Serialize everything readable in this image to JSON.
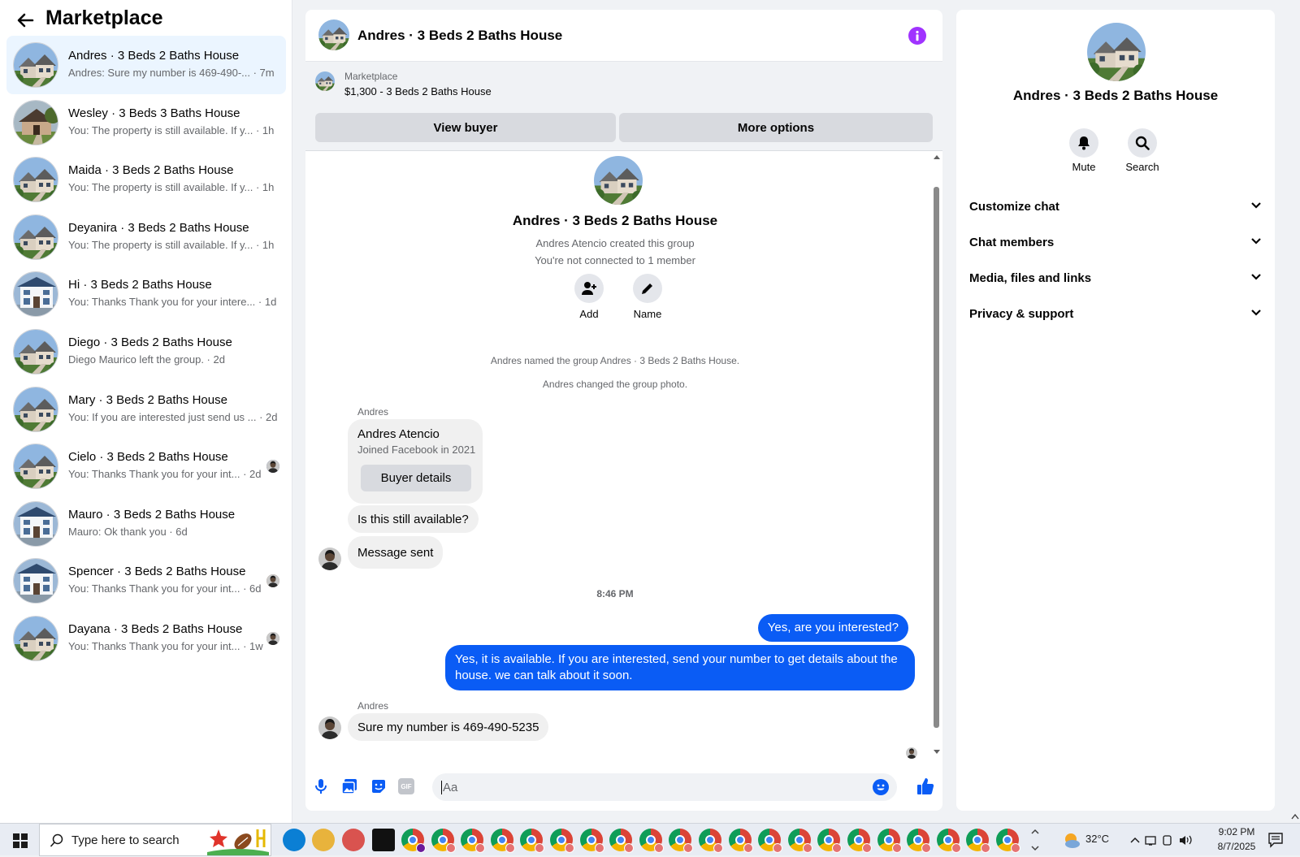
{
  "sidebar": {
    "title": "Marketplace",
    "conversations": [
      {
        "name": "Andres · 3 Beds 2 Baths House",
        "preview": "Andres: Sure my number is 469-490-... · 7m",
        "active": true
      },
      {
        "name": "Wesley · 3 Beds 3 Baths House",
        "preview": "You: The property is still available. If y... · 1h"
      },
      {
        "name": "Maida · 3 Beds 2 Baths House",
        "preview": "You: The property is still available. If y... · 1h"
      },
      {
        "name": "Deyanira · 3 Beds 2 Baths House",
        "preview": "You: The property is still available. If y... · 1h"
      },
      {
        "name": "Hi · 3 Beds 2 Baths House",
        "preview": "You: Thanks Thank you for your intere... · 1d"
      },
      {
        "name": "Diego · 3 Beds 2 Baths House",
        "preview": "Diego Maurico left the group. · 2d"
      },
      {
        "name": "Mary · 3 Beds 2 Baths House",
        "preview": "You: If you are interested just send us ... · 2d"
      },
      {
        "name": "Cielo · 3 Beds 2 Baths House",
        "preview": "You: Thanks Thank you for your int... · 2d"
      },
      {
        "name": "Mauro · 3 Beds 2 Baths House",
        "preview": "Mauro: Ok thank you · 6d"
      },
      {
        "name": "Spencer · 3 Beds 2 Baths House",
        "preview": "You: Thanks Thank you for your int... · 6d"
      },
      {
        "name": "Dayana · 3 Beds 2 Baths House",
        "preview": "You: Thanks Thank you for your int... · 1w"
      }
    ]
  },
  "chat": {
    "header_title": "Andres · 3 Beds 2 Baths House",
    "marketplace_label": "Marketplace",
    "listing": "$1,300 - 3 Beds 2 Baths House",
    "view_buyer": "View buyer",
    "more_options": "More options",
    "group_name": "Andres · 3 Beds 2 Baths House",
    "created_by": "Andres Atencio created this group",
    "not_connected": "You're not connected to 1 member",
    "add_label": "Add",
    "name_label": "Name",
    "sys_named": "Andres named the group Andres · 3 Beds 2 Baths House.",
    "sys_photo": "Andres changed the group photo.",
    "sender1": "Andres",
    "card_name": "Andres Atencio",
    "card_joined": "Joined Facebook in 2021",
    "buyer_details": "Buyer details",
    "msg_available": "Is this still available?",
    "msg_sent": "Message sent",
    "timestamp": "8:46 PM",
    "out1": "Yes, are you interested?",
    "out2": "Yes, it is available. If you are interested, send your number to get details about the house. we can talk about it soon.",
    "sender2": "Andres",
    "in_last": "Sure my number is 469-490-5235",
    "composer_placeholder": "Aa"
  },
  "info": {
    "title": "Andres · 3 Beds 2 Baths House",
    "mute": "Mute",
    "search": "Search",
    "sections": [
      "Customize chat",
      "Chat members",
      "Media, files and links",
      "Privacy & support"
    ]
  },
  "taskbar": {
    "search_placeholder": "Type here to search",
    "temperature": "32°C",
    "time": "9:02 PM",
    "date": "8/7/2025"
  },
  "colors": {
    "accent": "#0a5cf5",
    "info_icon": "#a033ff"
  }
}
